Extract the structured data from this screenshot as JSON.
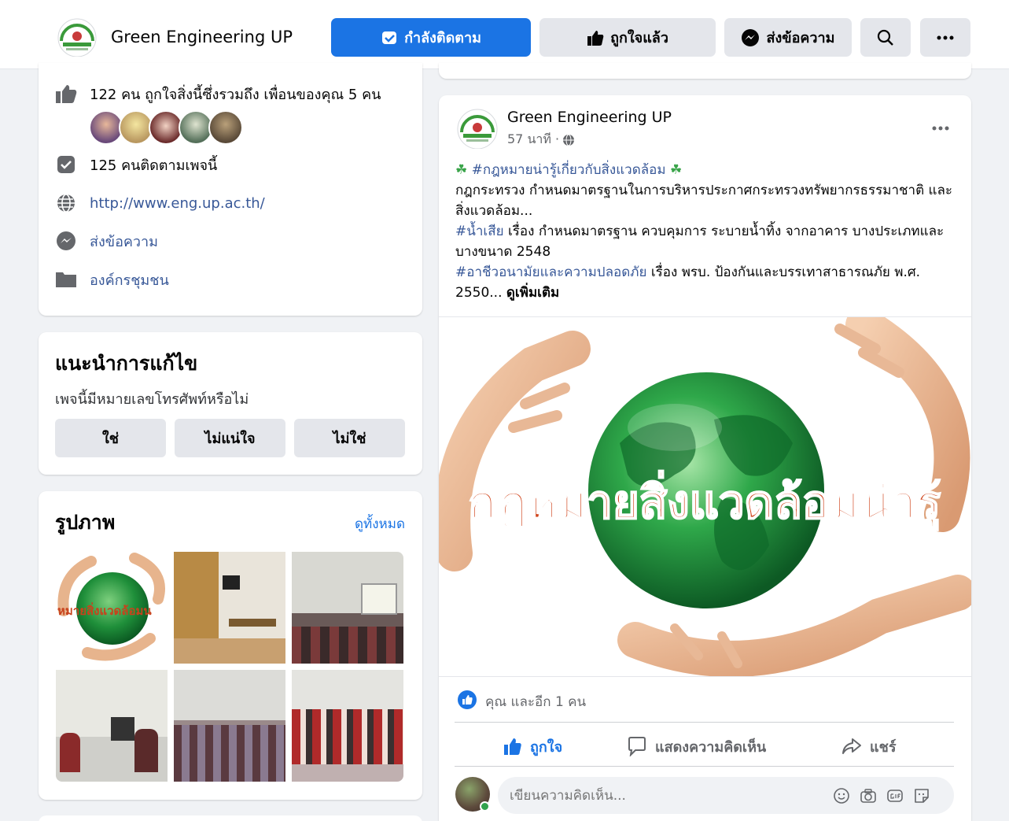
{
  "header": {
    "page_name": "Green Engineering UP",
    "follow_label": "กำลังติดตาม",
    "like_label": "ถูกใจแล้ว",
    "message_label": "ส่งข้อความ",
    "brand_color": "#1b74e4"
  },
  "about": {
    "likes_text": "122 คน ถูกใจสิ่งนี้ซึ่งรวมถึง เพื่อนของคุณ 5 คน",
    "followers_text": "125 คนติดตามเพจนี้",
    "website": "http://www.eng.up.ac.th/",
    "message_link": "ส่งข้อความ",
    "category": "องค์กรชุมชน"
  },
  "suggest": {
    "title": "แนะนำการแก้ไข",
    "question": "เพจนี้มีหมายเลขโทรศัพท์หรือไม่",
    "yes": "ใช่",
    "unsure": "ไม่แน่ใจ",
    "no": "ไม่ใช่"
  },
  "photos": {
    "title": "รูปภาพ",
    "see_all": "ดูทั้งหมด",
    "thumb1_text": "หมายสิ่งแวดล้อมน"
  },
  "post": {
    "author": "Green Engineering UP",
    "time": "57 นาที ·",
    "line1_tag": "#กฎหมายน่ารู้เกี่ยวกับสิ่งแวดล้อม",
    "line2": "กฎกระทรวง กำหนดมาตรฐานในการบริหารประกาศกระทรวงทรัพยากรธรรมาชาติ และสิ่งแวดล้อม...",
    "line3_tag": "#น้ำเสีย",
    "line3": " เรื่อง กำหนดมาตรฐาน ควบคุมการ ระบายน้ำทิ้ง จากอาคาร บางประเภทและบางขนาด 2548",
    "line4_tag": "#อาชีวอนามัยและความปลอดภัย",
    "line4": " เรื่อง พรบ. ป้องกันและบรรเทาสาธารณภัย พ.ศ. 2550... ",
    "see_more": "ดูเพิ่มเติม",
    "image_text": "กฎหมายสิ่งแวดล้อมน่ารู้",
    "reactions": "คุณ และอีก 1 คน",
    "like_action": "ถูกใจ",
    "comment_action": "แสดงความคิดเห็น",
    "share_action": "แชร์",
    "comment_placeholder": "เขียนความคิดเห็น..."
  }
}
